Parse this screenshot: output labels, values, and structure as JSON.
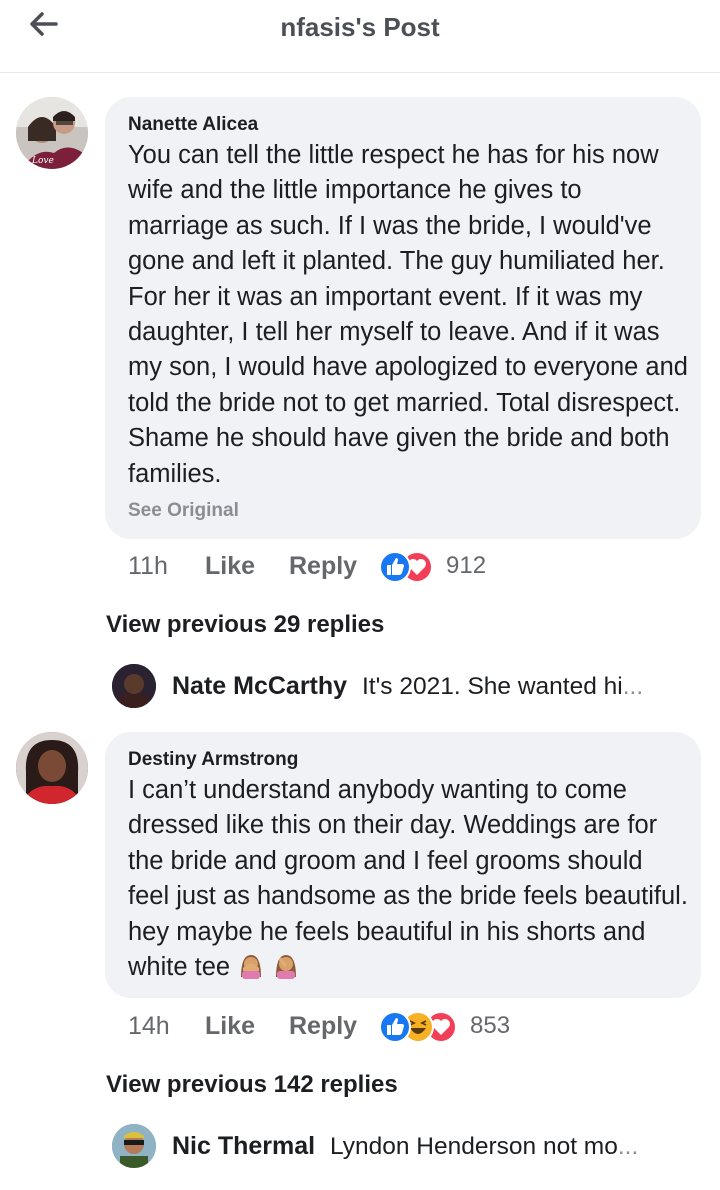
{
  "header": {
    "title": "nfasis's Post"
  },
  "comments": [
    {
      "author": "Nanette Alicea",
      "text": "You can tell the little respect he has for his now wife and the little importance he gives to marriage as such. If I was the bride, I would've gone and left it planted. The guy humiliated her. For her it was an important event. If it was my daughter, I tell her myself to leave. And if it was my son, I would have apologized to everyone and told the bride not to get married. Total disrespect. Shame he should have given the bride and both families.",
      "see_original": "See Original",
      "time": "11h",
      "like_label": "Like",
      "reply_label": "Reply",
      "reactions": [
        "like-reaction-icon",
        "love-reaction-icon"
      ],
      "reaction_count": "912",
      "view_previous": "View previous 29 replies",
      "reply": {
        "name": "Nate McCarthy",
        "snippet": "It's 2021. She wanted hi",
        "ellipsis": "..."
      }
    },
    {
      "author": "Destiny Armstrong",
      "text": "I can’t understand anybody wanting to come dressed like this on their day. Weddings are for the bride and groom and I feel grooms should feel just as handsome as the bride feels beautiful. hey maybe he feels beautiful in his shorts and white tee",
      "emojis": [
        "woman-facepalming-emoji",
        "woman-facepalming-emoji"
      ],
      "time": "14h",
      "like_label": "Like",
      "reply_label": "Reply",
      "reactions": [
        "like-reaction-icon",
        "haha-reaction-icon",
        "love-reaction-icon"
      ],
      "reaction_count": "853",
      "view_previous": "View previous 142 replies",
      "reply": {
        "name": "Nic Thermal",
        "snippet": "Lyndon Henderson not mo",
        "ellipsis": "..."
      }
    }
  ],
  "colors": {
    "like": "#1877f2",
    "love": "#f33e58",
    "haha": "#f7b125",
    "bubble": "#f0f2f5",
    "meta": "#65676b"
  }
}
